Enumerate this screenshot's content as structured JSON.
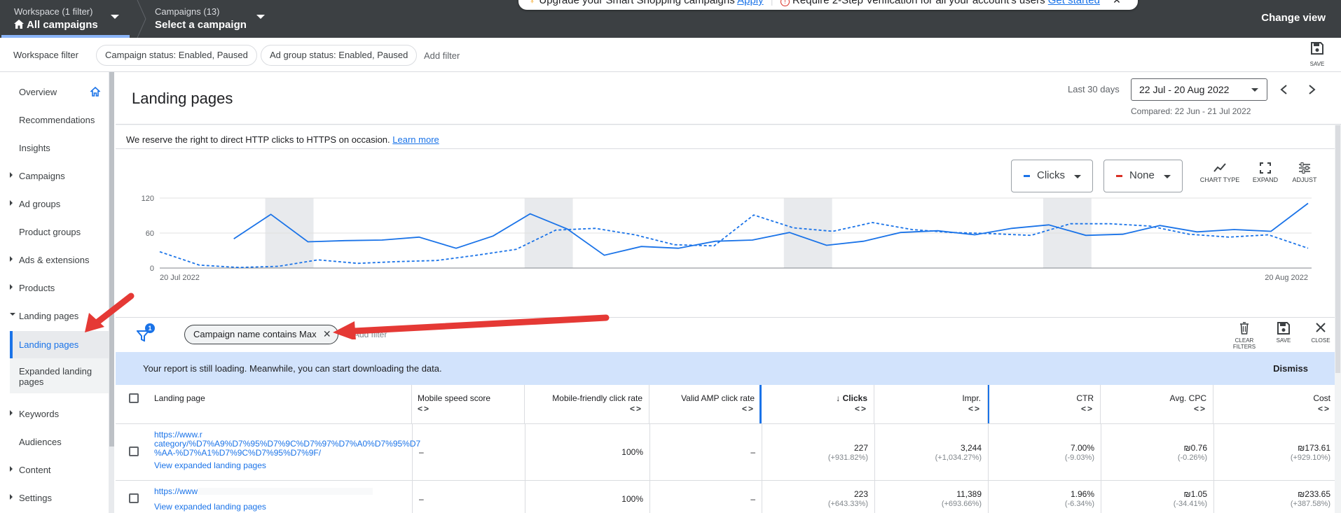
{
  "topbar": {
    "workspace_label": "Workspace (1 filter)",
    "workspace_value": "All campaigns",
    "campaigns_label": "Campaigns (13)",
    "campaigns_value": "Select a campaign",
    "notice_text_1": "Upgrade your Smart Shopping campaigns",
    "notice_link_1": "Apply",
    "notice_text_2": "Require 2-Step Verification for all your account's users",
    "notice_link_2": "Get started",
    "change_view": "Change view"
  },
  "filterbar": {
    "label": "Workspace filter",
    "chips": [
      "Campaign status: Enabled, Paused",
      "Ad group status: Enabled, Paused"
    ],
    "add_filter": "Add filter",
    "save_label": "SAVE"
  },
  "sidebar": {
    "items": [
      {
        "label": "Overview"
      },
      {
        "label": "Recommendations"
      },
      {
        "label": "Insights"
      },
      {
        "label": "Campaigns"
      },
      {
        "label": "Ad groups"
      },
      {
        "label": "Product groups"
      },
      {
        "label": "Ads & extensions"
      },
      {
        "label": "Products"
      },
      {
        "label": "Landing pages"
      },
      {
        "label": "Landing pages"
      },
      {
        "label": "Expanded landing pages"
      },
      {
        "label": "Keywords"
      },
      {
        "label": "Audiences"
      },
      {
        "label": "Content"
      },
      {
        "label": "Settings"
      }
    ]
  },
  "header": {
    "title": "Landing pages",
    "date_label": "Last 30 days",
    "date_range": "22 Jul - 20 Aug 2022",
    "compared": "Compared: 22 Jun - 21 Jul 2022"
  },
  "info": {
    "text": "We reserve the right to direct HTTP clicks to HTTPS on occasion.",
    "link": "Learn more"
  },
  "chart_controls": {
    "metric_1": "Clicks",
    "metric_2": "None",
    "tools": [
      "CHART TYPE",
      "EXPAND",
      "ADJUST"
    ],
    "colors": {
      "clicks": "#1a73e8",
      "none": "#d93025"
    }
  },
  "chart_data": {
    "type": "line",
    "x_start_label": "20 Jul 2022",
    "x_end_label": "20 Aug 2022",
    "y_ticks": [
      "120",
      "60",
      "0"
    ],
    "ylim": [
      0,
      120
    ],
    "x": [
      "20 Jul",
      "21 Jul",
      "22 Jul",
      "23 Jul",
      "24 Jul",
      "25 Jul",
      "26 Jul",
      "27 Jul",
      "28 Jul",
      "29 Jul",
      "30 Jul",
      "31 Jul",
      "1 Aug",
      "2 Aug",
      "3 Aug",
      "4 Aug",
      "5 Aug",
      "6 Aug",
      "7 Aug",
      "8 Aug",
      "9 Aug",
      "10 Aug",
      "11 Aug",
      "12 Aug",
      "13 Aug",
      "14 Aug",
      "15 Aug",
      "16 Aug",
      "17 Aug",
      "18 Aug",
      "19 Aug",
      "20 Aug"
    ],
    "series": [
      {
        "style": "solid",
        "values": [
          null,
          null,
          null,
          50,
          92,
          45,
          47,
          48,
          53,
          34,
          55,
          93,
          67,
          22,
          37,
          34,
          46,
          48,
          61,
          39,
          46,
          61,
          64,
          57,
          68,
          74,
          56,
          58,
          73,
          62,
          66,
          63,
          111
        ]
      },
      {
        "style": "dashed",
        "values": [
          28,
          5,
          1,
          3,
          14,
          8,
          11,
          13,
          22,
          32,
          65,
          68,
          57,
          40,
          38,
          91,
          69,
          63,
          78,
          66,
          61,
          59,
          56,
          76,
          76,
          72,
          58,
          53,
          57,
          34
        ]
      }
    ],
    "shaded_weekends": true
  },
  "filters": {
    "count": "1",
    "chip": "Campaign name contains Max",
    "add_filter": "Add filter",
    "tools": [
      "CLEAR FILTERS",
      "SAVE",
      "CLOSE"
    ]
  },
  "loading": {
    "text": "Your report is still loading. Meanwhile, you can start downloading the data.",
    "dismiss": "Dismiss"
  },
  "table": {
    "columns": [
      "Landing page",
      "Mobile speed score",
      "Mobile-friendly click rate",
      "Valid AMP click rate",
      "Clicks",
      "Impr.",
      "CTR",
      "Avg. CPC",
      "Cost"
    ],
    "rows": [
      {
        "url_line1": "https://www.r",
        "url_line2": "category/%D7%A9%D7%95%D7%9C%D7%97%D7%A0%D7%95%D7",
        "url_line3": "%AA-%D7%A1%D7%9C%D7%95%D7%9F/",
        "expanded_link": "View expanded landing pages",
        "mobile_speed": "–",
        "mobile_friendly": "100%",
        "amp": "–",
        "clicks": "227",
        "clicks_delta": "(+931.82%)",
        "impr": "3,244",
        "impr_delta": "(+1,034.27%)",
        "ctr": "7.00%",
        "ctr_delta": "(-9.03%)",
        "cpc": "₪0.76",
        "cpc_delta": "(-0.26%)",
        "cost": "₪173.61",
        "cost_delta": "(+929.10%)"
      },
      {
        "url_line1": "https://www",
        "url_line2": "",
        "url_line3": "",
        "expanded_link": "View expanded landing pages",
        "mobile_speed": "–",
        "mobile_friendly": "100%",
        "amp": "–",
        "clicks": "223",
        "clicks_delta": "(+643.33%)",
        "impr": "11,389",
        "impr_delta": "(+693.66%)",
        "ctr": "1.96%",
        "ctr_delta": "(-6.34%)",
        "cpc": "₪1.05",
        "cpc_delta": "(-34.41%)",
        "cost": "₪233.65",
        "cost_delta": "(+387.58%)"
      }
    ]
  }
}
